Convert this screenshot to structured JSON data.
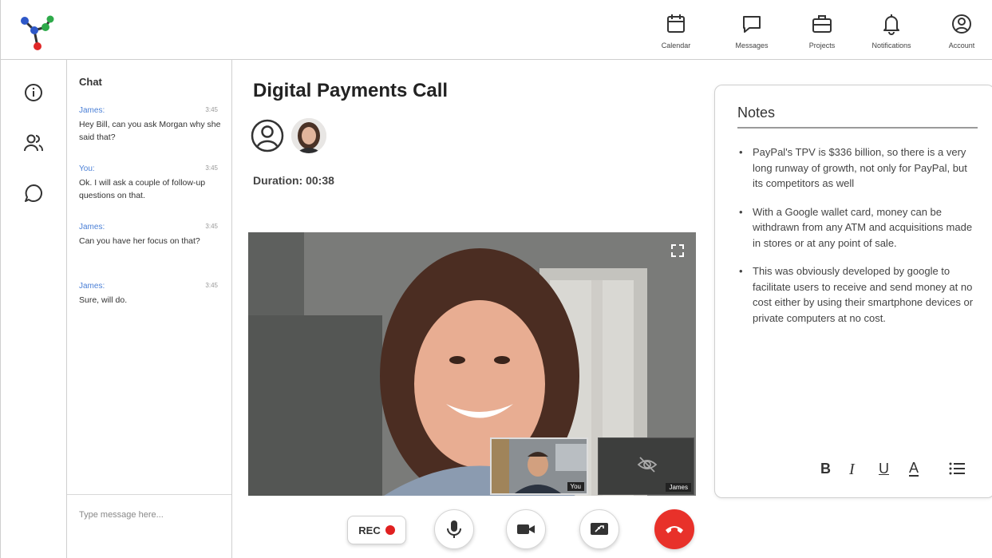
{
  "nav": {
    "items": [
      {
        "label": "Calendar",
        "icon": "calendar-icon"
      },
      {
        "label": "Messages",
        "icon": "messages-icon"
      },
      {
        "label": "Projects",
        "icon": "briefcase-icon"
      },
      {
        "label": "Notifications",
        "icon": "bell-icon"
      },
      {
        "label": "Account",
        "icon": "account-icon"
      }
    ]
  },
  "rail": {
    "icons": [
      "info-icon",
      "people-icon",
      "chat-bubble-icon"
    ]
  },
  "chat": {
    "title": "Chat",
    "messages": [
      {
        "from": "James:",
        "time": "3:45",
        "text": "Hey Bill, can you ask Morgan why she said that?"
      },
      {
        "from": "You:",
        "time": "3:45",
        "text": "Ok. I will ask a couple of follow-up questions on that."
      },
      {
        "from": "James:",
        "time": "3:45",
        "text": "Can you have her focus on that?"
      },
      {
        "from": "James:",
        "time": "3:45",
        "text": "Sure, will do."
      }
    ],
    "input_placeholder": "Type message here..."
  },
  "call": {
    "title": "Digital Payments Call",
    "duration": "Duration: 00:38",
    "tiles": {
      "you_label": "You",
      "james_label": "James"
    }
  },
  "controls": {
    "rec_label": "REC"
  },
  "notes": {
    "title": "Notes",
    "items": [
      "PayPal's TPV is $336 billion, so there is a very long runway of growth, not only for PayPal, but its competitors as well",
      "With a Google wallet card, money can be withdrawn from any ATM and acquisitions made in stores or at any point of sale.",
      "This was obviously developed by google to facilitate users to receive and send money at no cost either by using their smartphone devices or private computers at no cost."
    ]
  },
  "colors": {
    "accent": "#4a7fd6",
    "end_call": "#e8312a",
    "rec_dot": "#e02020"
  }
}
